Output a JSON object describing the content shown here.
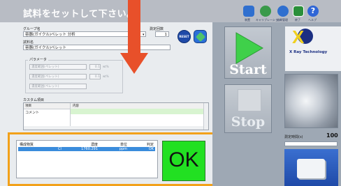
{
  "title": "試料をセットして下さい。",
  "toolbar": [
    {
      "label": "装置",
      "icon": "device-icon"
    },
    {
      "label": "キャリブレーション",
      "icon": "calibration-icon"
    },
    {
      "label": "結果管理",
      "icon": "results-icon"
    },
    {
      "label": "終了",
      "icon": "exit-icon"
    },
    {
      "label": "ヘルプ",
      "icon": "help-icon"
    }
  ],
  "form": {
    "group_label": "グループ名",
    "group_value": "容器(ガイクル)ペレット 分析",
    "count_label": "測定回数",
    "count_value": "1",
    "sample_label": "試料名",
    "sample_value": "容器(ガイクル)ペレット",
    "params_label": "パラメータ",
    "params": [
      {
        "label": "濃度範囲(ペレット)",
        "unit": "wt%"
      },
      {
        "label": "濃度範囲(ペレット)",
        "unit": "wt%"
      },
      {
        "label": "濃度範囲(ペレット)",
        "unit": ""
      }
    ],
    "custom_label": "カスタム項目",
    "custom_headers": [
      "項目",
      "内容"
    ],
    "custom_row": "コメント",
    "reset_label": "RESET"
  },
  "buttons": {
    "start": "Start",
    "stop": "Stop"
  },
  "brand": {
    "name": "X Ray Technology"
  },
  "measurement": {
    "label": "測定時間(s)",
    "value": "100",
    "progress": 0.0
  },
  "results": {
    "headers": [
      "構成物質",
      "濃度",
      "単位",
      "判定"
    ],
    "row": [
      "Cl",
      "1760.291",
      "ppm",
      "OK"
    ],
    "verdict": "OK"
  },
  "colors": {
    "accent_orange": "#f2a11a",
    "ok_green": "#22e022",
    "arrow_red": "#e8502a"
  }
}
